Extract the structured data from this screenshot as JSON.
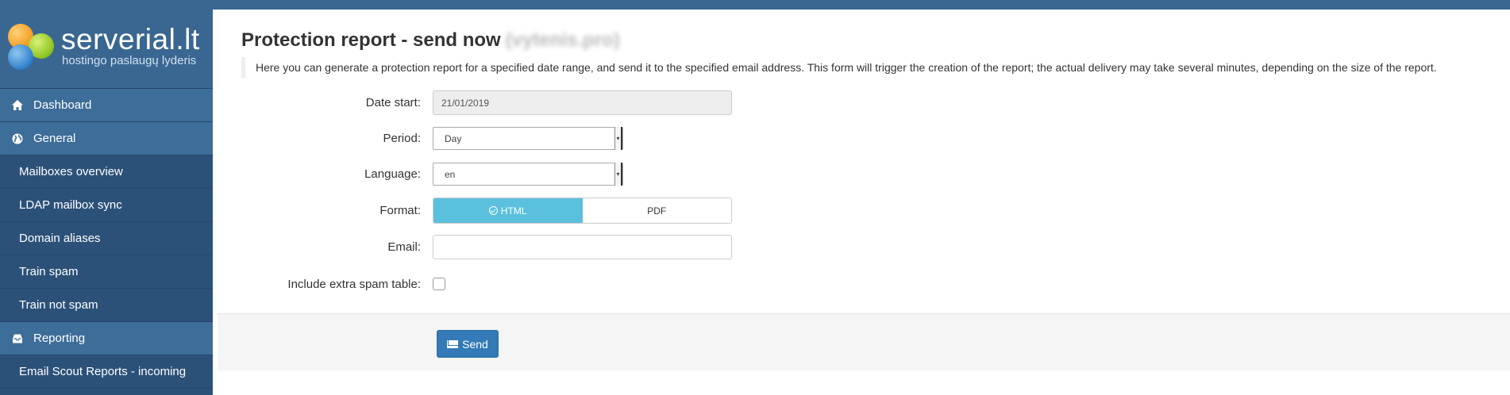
{
  "sidebar": {
    "brand": "serverial.lt",
    "tagline": "hostingo paslaugų lyderis",
    "items": [
      {
        "label": "Dashboard",
        "icon": "home-icon"
      },
      {
        "label": "General",
        "icon": "globe-icon"
      },
      {
        "label": "Mailboxes overview"
      },
      {
        "label": "LDAP mailbox sync"
      },
      {
        "label": "Domain aliases"
      },
      {
        "label": "Train spam"
      },
      {
        "label": "Train not spam"
      },
      {
        "label": "Reporting",
        "icon": "inbox-icon"
      },
      {
        "label": "Email Scout Reports - incoming"
      }
    ]
  },
  "page": {
    "title": "Protection report - send now",
    "title_suffix": "(vytenis.pro)",
    "description": "Here you can generate a protection report for a specified date range, and send it to the specified email address. This form will trigger the creation of the report; the actual delivery may take several minutes, depending on the size of the report."
  },
  "form": {
    "date_start_label": "Date start:",
    "date_start_value": "21/01/2019",
    "period_label": "Period:",
    "period_value": "Day",
    "language_label": "Language:",
    "language_value": "en",
    "format_label": "Format:",
    "format_options": [
      "HTML",
      "PDF"
    ],
    "format_selected": "HTML",
    "email_label": "Email:",
    "email_value": "",
    "extra_spam_label": "Include extra spam table:",
    "extra_spam_checked": false,
    "send_label": "Send"
  },
  "colors": {
    "sidebar_bg": "#2c5179",
    "section_bg": "#3d6d99",
    "toggle_active": "#5bc0de",
    "primary_button": "#337ab7"
  }
}
